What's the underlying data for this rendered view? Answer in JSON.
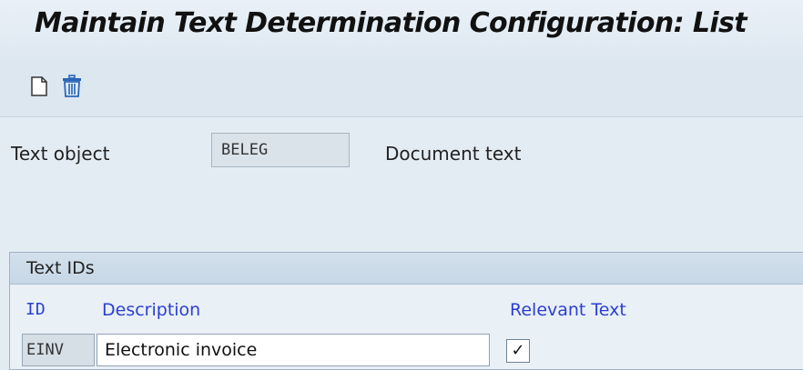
{
  "window": {
    "title": "Maintain Text Determination Configuration: List"
  },
  "toolbar": {
    "buttons": [
      {
        "name": "new-entry",
        "icon": "new-document-icon"
      },
      {
        "name": "delete",
        "icon": "trash-icon"
      }
    ]
  },
  "header": {
    "text_object_label": "Text object",
    "text_object_value": "BELEG",
    "text_object_description": "Document text"
  },
  "text_ids": {
    "group_title": "Text IDs",
    "columns": {
      "id": "ID",
      "description": "Description",
      "relevant": "Relevant Text"
    },
    "rows": [
      {
        "id": "EINV",
        "description": "Electronic invoice",
        "relevant_mark": "✓"
      }
    ]
  },
  "colors": {
    "column_header": "#2b3fd1",
    "trash_icon": "#2a66b8"
  }
}
